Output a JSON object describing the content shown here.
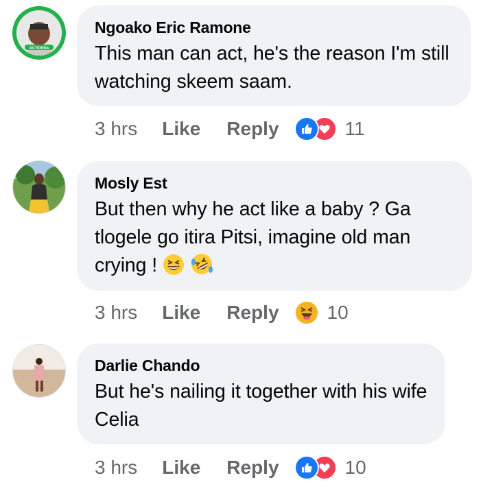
{
  "comments": [
    {
      "author": "Ngoako Eric Ramone",
      "text": "This man can act, he's the reason I'm still watching skeem saam.",
      "time": "3 hrs",
      "like_label": "Like",
      "reply_label": "Reply",
      "reactions": [
        "like-icon",
        "love-icon"
      ],
      "reaction_count": "11",
      "avatar_badge": "ACTIONSA"
    },
    {
      "author": "Mosly Est",
      "text": "But then why he act like a baby ? Ga tlogele go itira Pitsi, imagine old man crying !",
      "text_emojis": [
        "grinning-squinting-face",
        "rolling-on-floor-laughing-face"
      ],
      "time": "3 hrs",
      "like_label": "Like",
      "reply_label": "Reply",
      "reactions": [
        "haha-icon"
      ],
      "reaction_count": "10"
    },
    {
      "author": "Darlie Chando",
      "text": "But he's nailing it together with his wife Celia",
      "time": "3 hrs",
      "like_label": "Like",
      "reply_label": "Reply",
      "reactions": [
        "like-icon",
        "love-icon"
      ],
      "reaction_count": "10"
    }
  ],
  "colors": {
    "bubble": "#f0f2f5",
    "meta_text": "#65676b",
    "like_blue": "#1877f2",
    "love_red": "#f33e58",
    "haha_yellow": "#f7b125",
    "actionsa_green": "#22b14c"
  }
}
